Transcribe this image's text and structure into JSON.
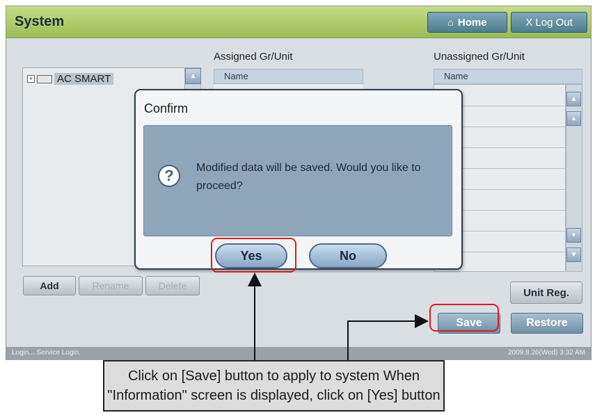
{
  "header": {
    "title": "System",
    "home_label": "Home",
    "logout_label": "X Log Out"
  },
  "assigned": {
    "label": "Assigned Gr/Unit",
    "column_header": "Name"
  },
  "unassigned": {
    "label": "Unassigned Gr/Unit",
    "column_header": "Name"
  },
  "tree": {
    "items": [
      {
        "label": "AC SMART",
        "expander": "⊞"
      }
    ]
  },
  "buttons": {
    "add": "Add",
    "rename": "Rename",
    "delete": "Delete",
    "unit_reg": "Unit Reg.",
    "save": "Save",
    "restore": "Restore"
  },
  "status": {
    "left": "Login... Service Login.",
    "right": "2009.8.26(Wed)  3:32 AM"
  },
  "dialog": {
    "title": "Confirm",
    "icon": "question-icon",
    "message": "Modified data will be saved.  Would you like to proceed?",
    "yes_label": "Yes",
    "no_label": "No"
  },
  "callout": {
    "text": "Click on [Save] button to apply to system When \"Information\" screen is displayed, click on [Yes] button"
  },
  "colors": {
    "titlebar": "#a8c463",
    "highlight": "#e3191d",
    "dialog_panel": "#8fa5b9"
  }
}
